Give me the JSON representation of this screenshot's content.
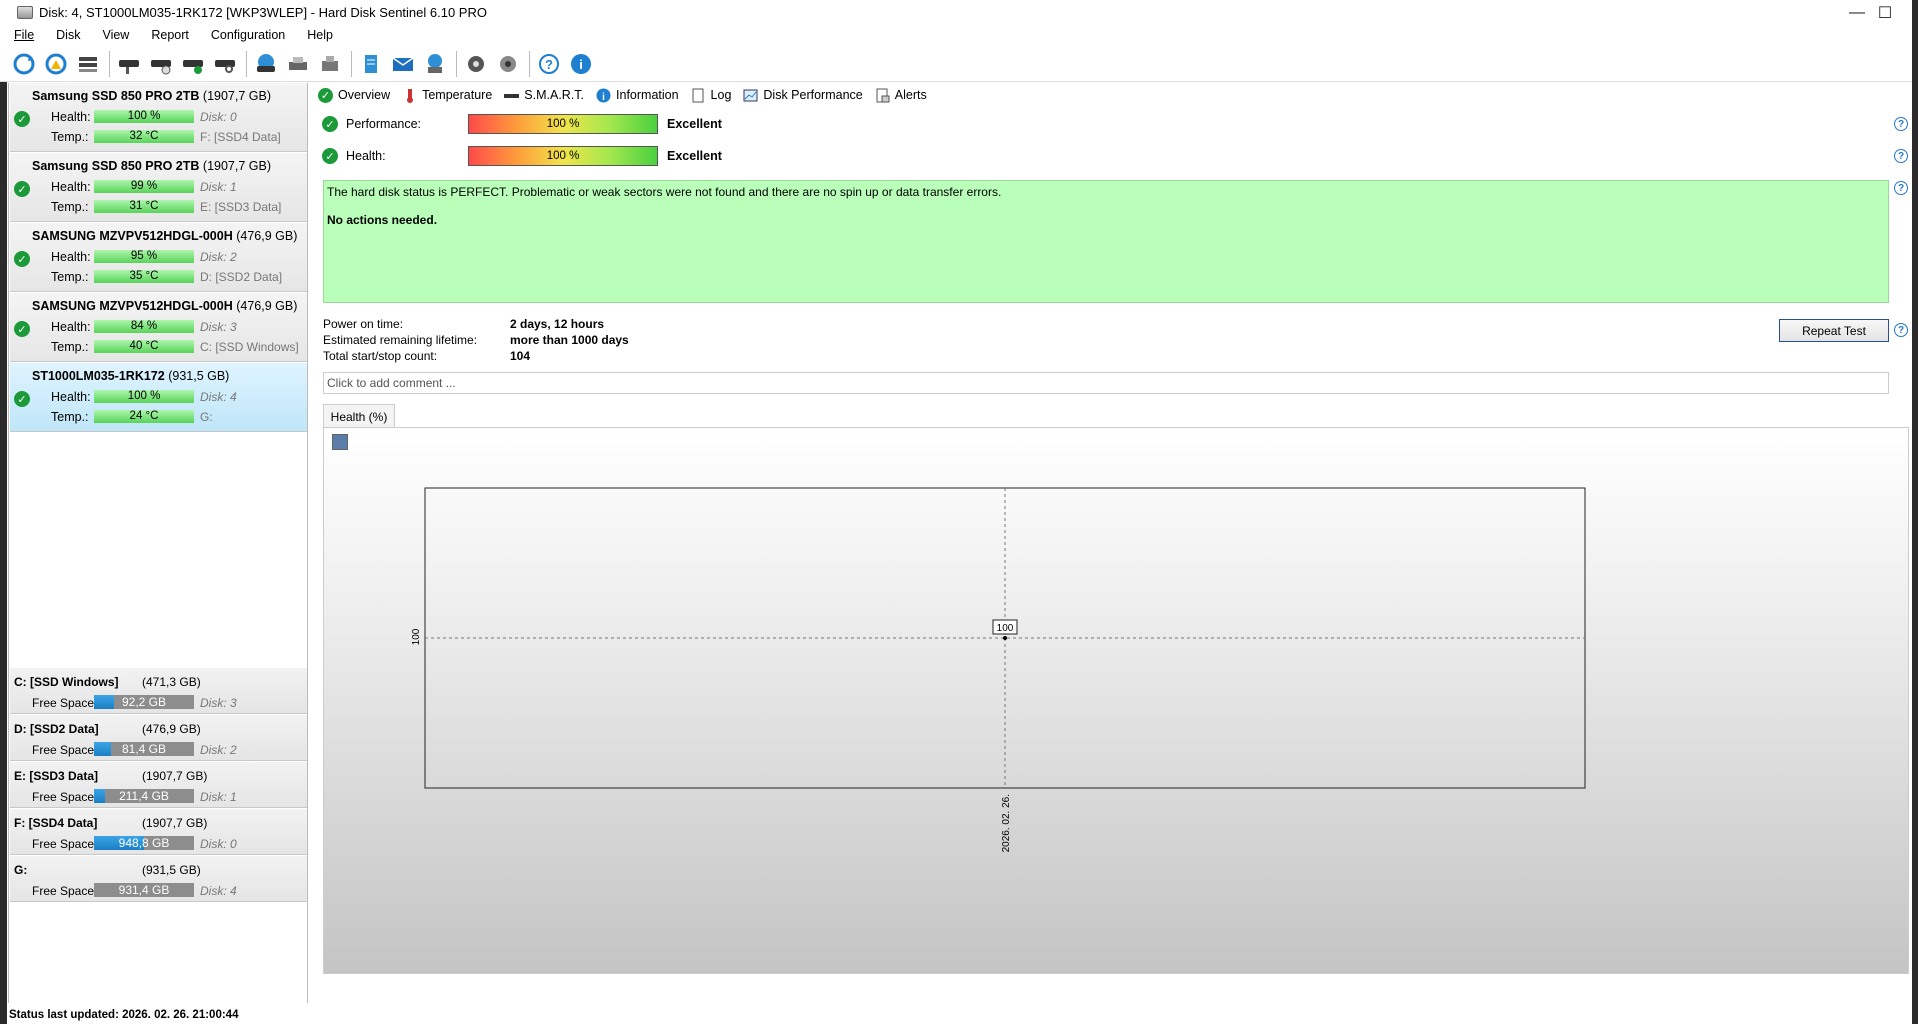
{
  "window": {
    "title": "Disk: 4, ST1000LM035-1RK172 [WKP3WLEP]  -  Hard Disk Sentinel 6.10 PRO",
    "minimize": "—",
    "maximize": "☐",
    "close": "✕"
  },
  "menu": [
    "File",
    "Disk",
    "View",
    "Report",
    "Configuration",
    "Help"
  ],
  "toolbar_icons": [
    "refresh-icon",
    "refresh-warning-icon",
    "drive-list-icon",
    "disk-icon",
    "disk-schedule-icon",
    "disk-ok-icon",
    "disk-search-icon",
    "globe-disk-icon",
    "printer-icon",
    "drive-export-icon",
    "report-icon",
    "mail-icon",
    "network-icon",
    "settings-icon",
    "sound-icon",
    "help-icon",
    "info-icon"
  ],
  "disks": [
    {
      "name": "Samsung SSD 850 PRO 2TB",
      "size": "(1907,7 GB)",
      "health_label": "Health:",
      "health": "100 %",
      "health_pct": 100,
      "disk": "Disk: 0",
      "temp_label": "Temp.:",
      "temp": "32 °C",
      "volume": "F: [SSD4 Data]"
    },
    {
      "name": "Samsung SSD 850 PRO 2TB",
      "size": "(1907,7 GB)",
      "health_label": "Health:",
      "health": "99 %",
      "health_pct": 99,
      "disk": "Disk: 1",
      "temp_label": "Temp.:",
      "temp": "31 °C",
      "volume": "E: [SSD3 Data]"
    },
    {
      "name": "SAMSUNG MZVPV512HDGL-000H",
      "size": "(476,9 GB)",
      "health_label": "Health:",
      "health": "95 %",
      "health_pct": 95,
      "disk": "Disk: 2",
      "temp_label": "Temp.:",
      "temp": "35 °C",
      "volume": "D: [SSD2 Data]"
    },
    {
      "name": "SAMSUNG MZVPV512HDGL-000H",
      "size": "(476,9 GB)",
      "health_label": "Health:",
      "health": "84 %",
      "health_pct": 84,
      "disk": "Disk: 3",
      "temp_label": "Temp.:",
      "temp": "40 °C",
      "volume": "C: [SSD Windows]"
    },
    {
      "name": "ST1000LM035-1RK172",
      "size": "(931,5 GB)",
      "health_label": "Health:",
      "health": "100 %",
      "health_pct": 100,
      "disk": "Disk: 4",
      "temp_label": "Temp.:",
      "temp": "24 °C",
      "volume": "G:",
      "selected": true
    }
  ],
  "volumes": [
    {
      "name": "C: [SSD Windows]",
      "size": "(471,3 GB)",
      "label": "Free Space",
      "free": "92,2 GB",
      "free_frac": 0.196,
      "disk": "Disk: 3"
    },
    {
      "name": "D: [SSD2 Data]",
      "size": "(476,9 GB)",
      "label": "Free Space",
      "free": "81,4 GB",
      "free_frac": 0.171,
      "disk": "Disk: 2"
    },
    {
      "name": "E: [SSD3 Data]",
      "size": "(1907,7 GB)",
      "label": "Free Space",
      "free": "211,4 GB",
      "free_frac": 0.111,
      "disk": "Disk: 1"
    },
    {
      "name": "F: [SSD4 Data]",
      "size": "(1907,7 GB)",
      "label": "Free Space",
      "free": "948,8 GB",
      "free_frac": 0.497,
      "disk": "Disk: 0"
    },
    {
      "name": "G:",
      "size": "(931,5 GB)",
      "label": "Free Space",
      "free": "931,4 GB",
      "free_frac": 1.0,
      "disk": "Disk: 4"
    }
  ],
  "tabs": [
    "Overview",
    "Temperature",
    "S.M.A.R.T.",
    "Information",
    "Log",
    "Disk Performance",
    "Alerts"
  ],
  "overview": {
    "performance_label": "Performance:",
    "performance_value": "100 %",
    "performance_pct": 100,
    "performance_text": "Excellent",
    "health_label": "Health:",
    "health_value": "100 %",
    "health_pct": 100,
    "health_text": "Excellent",
    "status_message": "The hard disk status is PERFECT. Problematic or weak sectors were not found and there are no spin up or data transfer errors.",
    "action_message": "No actions needed.",
    "power_on_label": "Power on time:",
    "power_on_value": "2 days, 12 hours",
    "lifetime_label": "Estimated remaining lifetime:",
    "lifetime_value": "more than 1000 days",
    "startstop_label": "Total start/stop count:",
    "startstop_value": "104",
    "repeat_button": "Repeat Test",
    "comment_placeholder": "Click to add comment ..."
  },
  "chart_tab": "Health (%)",
  "chart_data": {
    "type": "line",
    "x": [
      "2026. 02. 26."
    ],
    "series": [
      {
        "values": [
          100
        ]
      }
    ],
    "ytick": "100",
    "xtick": "2026. 02. 26.",
    "point_label": "100",
    "grid": true
  },
  "statusbar": "Status last updated: 2026. 02. 26. 21:00:44",
  "colors": {
    "ok_green": "#1c9a3a",
    "status_bg": "#b9ffb9",
    "bar_green": "#58d358",
    "free_blue": "#1b7fc4"
  }
}
